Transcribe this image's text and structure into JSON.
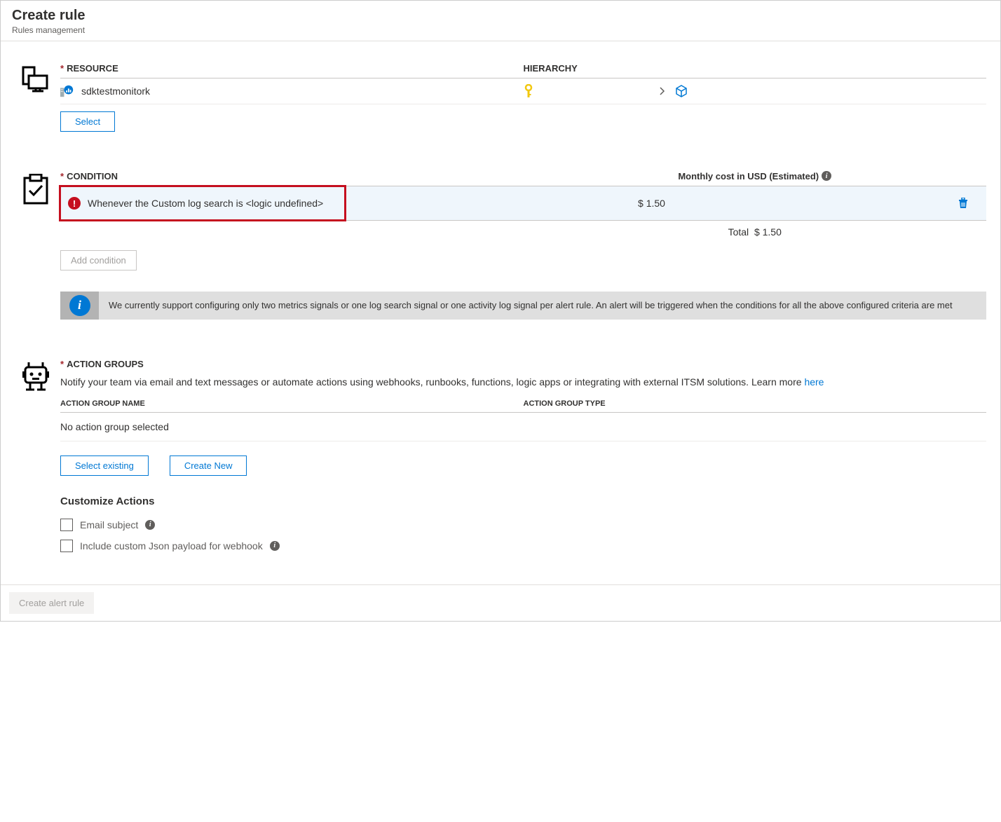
{
  "header": {
    "title": "Create rule",
    "subtitle": "Rules management"
  },
  "resource": {
    "label": "RESOURCE",
    "hierarchy_label": "HIERARCHY",
    "name": "sdktestmonitork",
    "select_button": "Select"
  },
  "condition": {
    "label": "CONDITION",
    "cost_label": "Monthly cost in USD (Estimated)",
    "text": "Whenever the Custom log search is <logic undefined>",
    "cost": "$ 1.50",
    "total_label": "Total",
    "total_value": "$ 1.50",
    "add_button": "Add condition",
    "info_text": "We currently support configuring only two metrics signals or one log search signal or one activity log signal per alert rule. An alert will be triggered when the conditions for all the above configured criteria are met"
  },
  "action_groups": {
    "label": "ACTION GROUPS",
    "description": "Notify your team via email and text messages or automate actions using webhooks, runbooks, functions, logic apps or integrating with external ITSM solutions. Learn more ",
    "learn_more": "here",
    "col_name": "ACTION GROUP NAME",
    "col_type": "ACTION GROUP TYPE",
    "empty_text": "No action group selected",
    "select_existing": "Select existing",
    "create_new": "Create New",
    "customize_title": "Customize Actions",
    "email_subject": "Email subject",
    "custom_json": "Include custom Json payload for webhook"
  },
  "footer": {
    "create_button": "Create alert rule"
  }
}
